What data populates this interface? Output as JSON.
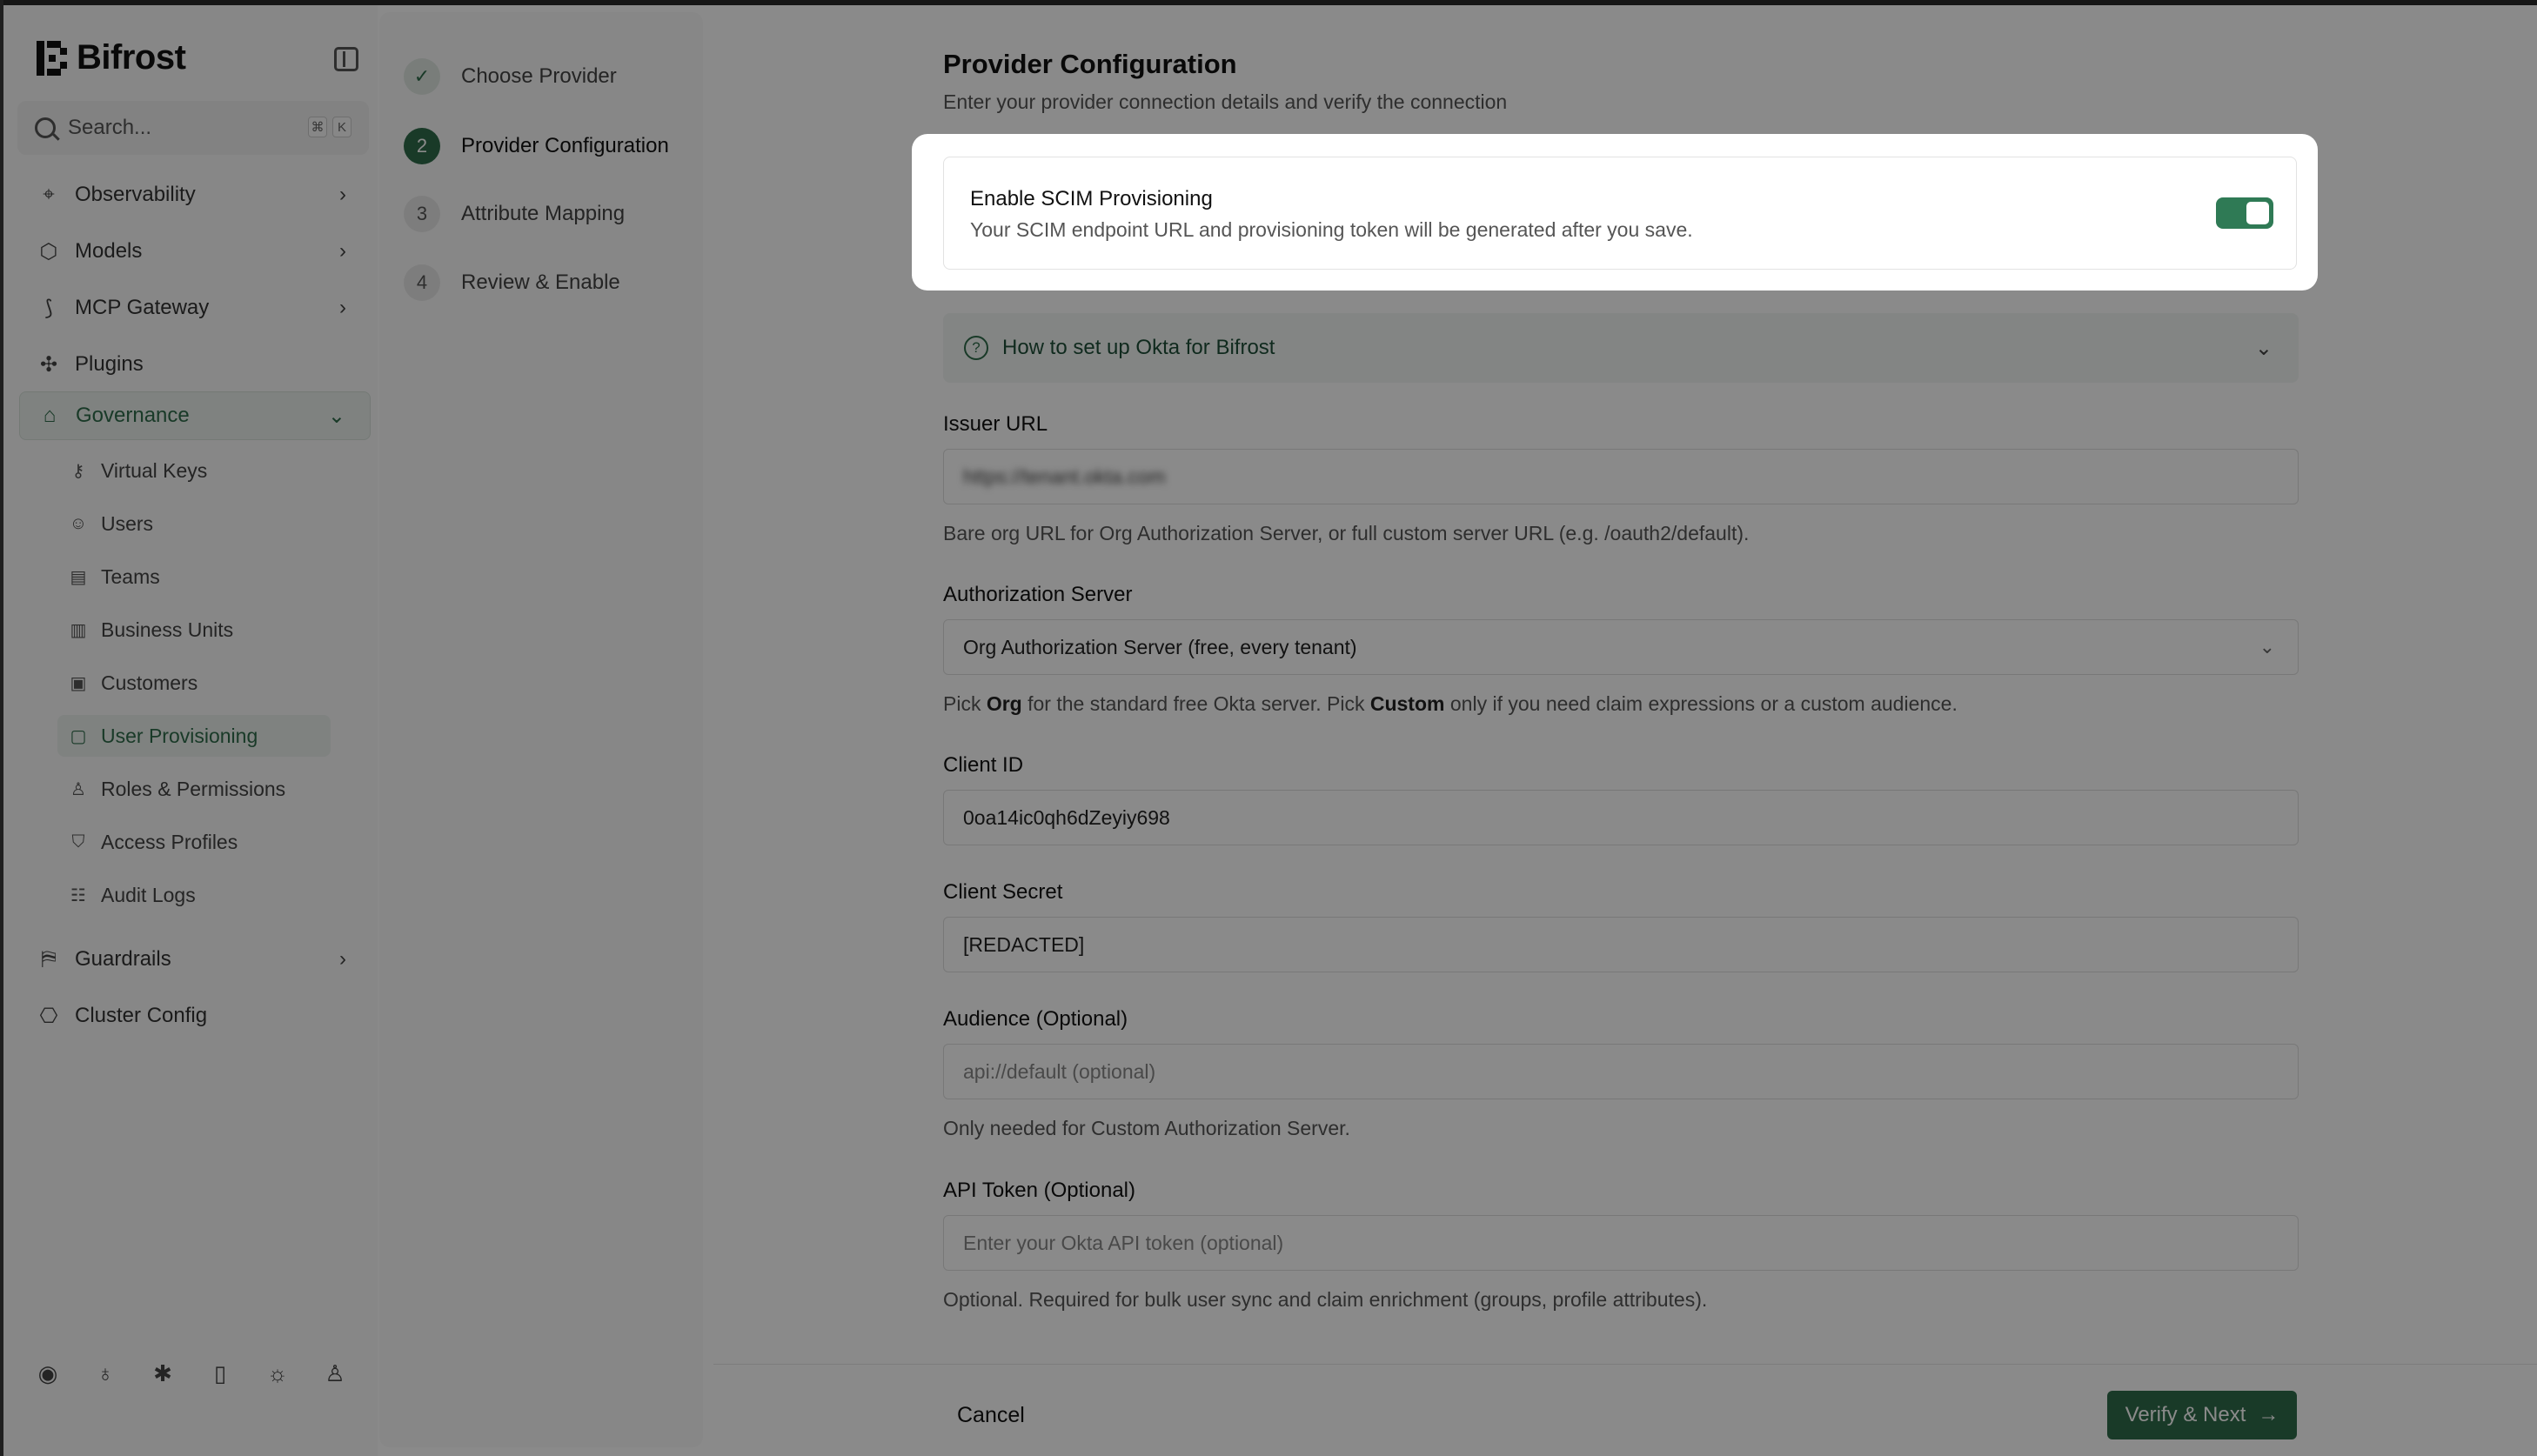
{
  "app": {
    "name": "Bifrost",
    "colors": {
      "accent": "#2f6b4a",
      "toggle_on": "#2f7a55",
      "overlay": "rgba(0,0,0,0.46)"
    }
  },
  "search": {
    "placeholder": "Search...",
    "shortcut": [
      "⌘",
      "K"
    ]
  },
  "sidebar": {
    "items": [
      {
        "label": "Observability",
        "icon": "telescope-icon",
        "has_chevron": true
      },
      {
        "label": "Models",
        "icon": "cube-icon",
        "has_chevron": true
      },
      {
        "label": "MCP Gateway",
        "icon": "mcp-icon",
        "has_chevron": true
      },
      {
        "label": "Plugins",
        "icon": "puzzle-icon",
        "has_chevron": false
      },
      {
        "label": "Governance",
        "icon": "landmark-icon",
        "has_chevron": true,
        "expanded": true
      },
      {
        "label": "Guardrails",
        "icon": "barrier-icon",
        "has_chevron": true
      },
      {
        "label": "Cluster Config",
        "icon": "network-icon",
        "has_chevron": false
      }
    ],
    "governance_children": [
      {
        "label": "Virtual Keys",
        "icon": "key-icon"
      },
      {
        "label": "Users",
        "icon": "users-icon"
      },
      {
        "label": "Teams",
        "icon": "building-icon"
      },
      {
        "label": "Business Units",
        "icon": "buildings-icon"
      },
      {
        "label": "Customers",
        "icon": "store-icon"
      },
      {
        "label": "User Provisioning",
        "icon": "id-badge-icon",
        "active": true
      },
      {
        "label": "Roles & Permissions",
        "icon": "user-role-icon"
      },
      {
        "label": "Access Profiles",
        "icon": "shield-icon"
      },
      {
        "label": "Audit Logs",
        "icon": "scroll-icon"
      }
    ],
    "footer_icons": [
      "discord-icon",
      "github-icon",
      "bug-icon",
      "docs-icon",
      "sun-icon",
      "user-icon"
    ]
  },
  "stepper": {
    "steps": [
      {
        "number": "",
        "label": "Choose Provider",
        "state": "done"
      },
      {
        "number": "2",
        "label": "Provider Configuration",
        "state": "current"
      },
      {
        "number": "3",
        "label": "Attribute Mapping",
        "state": "pending"
      },
      {
        "number": "4",
        "label": "Review & Enable",
        "state": "pending"
      }
    ]
  },
  "main": {
    "title": "Provider Configuration",
    "subtitle": "Enter your provider connection details and verify the connection",
    "scim": {
      "title": "Enable SCIM Provisioning",
      "description": "Your SCIM endpoint URL and provisioning token will be generated after you save.",
      "enabled": true
    },
    "howto": {
      "label": "How to set up Okta for Bifrost"
    },
    "issuer_url": {
      "label": "Issuer URL",
      "value": "https://tenant.okta.com",
      "help": "Bare org URL for Org Authorization Server, or full custom server URL (e.g. /oauth2/default)."
    },
    "auth_server": {
      "label": "Authorization Server",
      "value": "Org Authorization Server (free, every tenant)",
      "help_prefix": "Pick ",
      "help_org": "Org",
      "help_mid": " for the standard free Okta server. Pick ",
      "help_custom": "Custom",
      "help_suffix": " only if you need claim expressions or a custom audience."
    },
    "client_id": {
      "label": "Client ID",
      "value": "0oa14ic0qh6dZeyiy698"
    },
    "client_secret": {
      "label": "Client Secret",
      "value": "[REDACTED]"
    },
    "audience": {
      "label": "Audience (Optional)",
      "placeholder": "api://default (optional)",
      "help": "Only needed for Custom Authorization Server."
    },
    "api_token": {
      "label": "API Token (Optional)",
      "placeholder": "Enter your Okta API token (optional)",
      "help": "Optional. Required for bulk user sync and claim enrichment (groups, profile attributes)."
    },
    "actions": {
      "cancel": "Cancel",
      "verify": "Verify & Next"
    }
  }
}
